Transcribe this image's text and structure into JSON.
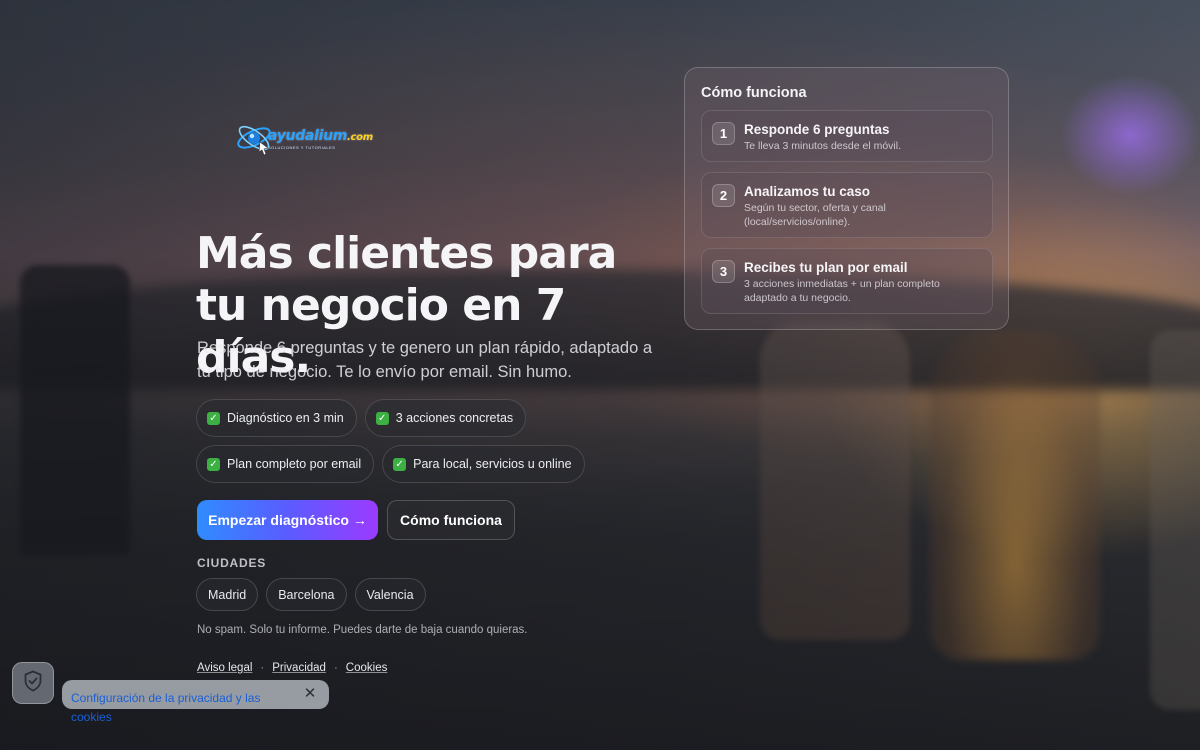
{
  "brand": {
    "logo_word": "ayudalium",
    "logo_domain": ".com",
    "logo_tagline": "SOLUCIONES Y TUTORIALES"
  },
  "hero": {
    "title": "Más clientes para tu negocio en 7 días.",
    "subtitle": "Responde 6 preguntas y te genero un plan rápido, adaptado a tu tipo de negocio. Te lo envío por email. Sin humo."
  },
  "features": [
    "Diagnóstico en 3 min",
    "3 acciones concretas",
    "Plan completo por email",
    "Para local, servicios u online"
  ],
  "cta": {
    "primary_label": "Empezar diagnóstico →",
    "secondary_label": "Cómo funciona"
  },
  "cities": {
    "label": "CIUDADES",
    "items": [
      "Madrid",
      "Barcelona",
      "Valencia"
    ]
  },
  "note": "No spam. Solo tu informe. Puedes darte de baja cuando quieras.",
  "footer": {
    "links": [
      "Aviso legal",
      "Privacidad",
      "Cookies"
    ],
    "separator": "·"
  },
  "how_it_works": {
    "title": "Cómo funciona",
    "steps": [
      {
        "number": "1",
        "title": "Responde 6 preguntas",
        "description": "Te lleva 3 minutos desde el móvil."
      },
      {
        "number": "2",
        "title": "Analizamos tu caso",
        "description": "Según tu sector, oferta y canal (local/servicios/online)."
      },
      {
        "number": "3",
        "title": "Recibes tu plan por email",
        "description": "3 acciones inmediatas + un plan completo adaptado a tu negocio."
      }
    ]
  },
  "privacy": {
    "tooltip": "Configuración de la privacidad y las cookies",
    "close_glyph": "✕",
    "icon": "shield-icon"
  },
  "colors": {
    "check": "#3cb043",
    "cta_gradient_start": "#2f8cff",
    "cta_gradient_end": "#9b3bff",
    "privacy_link": "#1a5fd6"
  }
}
